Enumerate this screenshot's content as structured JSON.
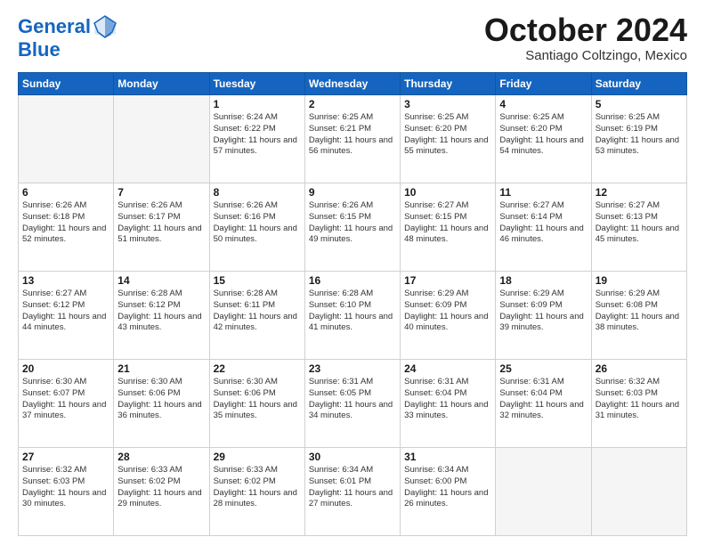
{
  "header": {
    "logo_line1": "General",
    "logo_line2": "Blue",
    "month": "October 2024",
    "location": "Santiago Coltzingo, Mexico"
  },
  "days_of_week": [
    "Sunday",
    "Monday",
    "Tuesday",
    "Wednesday",
    "Thursday",
    "Friday",
    "Saturday"
  ],
  "weeks": [
    [
      {
        "day": "",
        "empty": true
      },
      {
        "day": "",
        "empty": true
      },
      {
        "day": "1",
        "sunrise": "6:24 AM",
        "sunset": "6:22 PM",
        "daylight": "11 hours and 57 minutes."
      },
      {
        "day": "2",
        "sunrise": "6:25 AM",
        "sunset": "6:21 PM",
        "daylight": "11 hours and 56 minutes."
      },
      {
        "day": "3",
        "sunrise": "6:25 AM",
        "sunset": "6:20 PM",
        "daylight": "11 hours and 55 minutes."
      },
      {
        "day": "4",
        "sunrise": "6:25 AM",
        "sunset": "6:20 PM",
        "daylight": "11 hours and 54 minutes."
      },
      {
        "day": "5",
        "sunrise": "6:25 AM",
        "sunset": "6:19 PM",
        "daylight": "11 hours and 53 minutes."
      }
    ],
    [
      {
        "day": "6",
        "sunrise": "6:26 AM",
        "sunset": "6:18 PM",
        "daylight": "11 hours and 52 minutes."
      },
      {
        "day": "7",
        "sunrise": "6:26 AM",
        "sunset": "6:17 PM",
        "daylight": "11 hours and 51 minutes."
      },
      {
        "day": "8",
        "sunrise": "6:26 AM",
        "sunset": "6:16 PM",
        "daylight": "11 hours and 50 minutes."
      },
      {
        "day": "9",
        "sunrise": "6:26 AM",
        "sunset": "6:15 PM",
        "daylight": "11 hours and 49 minutes."
      },
      {
        "day": "10",
        "sunrise": "6:27 AM",
        "sunset": "6:15 PM",
        "daylight": "11 hours and 48 minutes."
      },
      {
        "day": "11",
        "sunrise": "6:27 AM",
        "sunset": "6:14 PM",
        "daylight": "11 hours and 46 minutes."
      },
      {
        "day": "12",
        "sunrise": "6:27 AM",
        "sunset": "6:13 PM",
        "daylight": "11 hours and 45 minutes."
      }
    ],
    [
      {
        "day": "13",
        "sunrise": "6:27 AM",
        "sunset": "6:12 PM",
        "daylight": "11 hours and 44 minutes."
      },
      {
        "day": "14",
        "sunrise": "6:28 AM",
        "sunset": "6:12 PM",
        "daylight": "11 hours and 43 minutes."
      },
      {
        "day": "15",
        "sunrise": "6:28 AM",
        "sunset": "6:11 PM",
        "daylight": "11 hours and 42 minutes."
      },
      {
        "day": "16",
        "sunrise": "6:28 AM",
        "sunset": "6:10 PM",
        "daylight": "11 hours and 41 minutes."
      },
      {
        "day": "17",
        "sunrise": "6:29 AM",
        "sunset": "6:09 PM",
        "daylight": "11 hours and 40 minutes."
      },
      {
        "day": "18",
        "sunrise": "6:29 AM",
        "sunset": "6:09 PM",
        "daylight": "11 hours and 39 minutes."
      },
      {
        "day": "19",
        "sunrise": "6:29 AM",
        "sunset": "6:08 PM",
        "daylight": "11 hours and 38 minutes."
      }
    ],
    [
      {
        "day": "20",
        "sunrise": "6:30 AM",
        "sunset": "6:07 PM",
        "daylight": "11 hours and 37 minutes."
      },
      {
        "day": "21",
        "sunrise": "6:30 AM",
        "sunset": "6:06 PM",
        "daylight": "11 hours and 36 minutes."
      },
      {
        "day": "22",
        "sunrise": "6:30 AM",
        "sunset": "6:06 PM",
        "daylight": "11 hours and 35 minutes."
      },
      {
        "day": "23",
        "sunrise": "6:31 AM",
        "sunset": "6:05 PM",
        "daylight": "11 hours and 34 minutes."
      },
      {
        "day": "24",
        "sunrise": "6:31 AM",
        "sunset": "6:04 PM",
        "daylight": "11 hours and 33 minutes."
      },
      {
        "day": "25",
        "sunrise": "6:31 AM",
        "sunset": "6:04 PM",
        "daylight": "11 hours and 32 minutes."
      },
      {
        "day": "26",
        "sunrise": "6:32 AM",
        "sunset": "6:03 PM",
        "daylight": "11 hours and 31 minutes."
      }
    ],
    [
      {
        "day": "27",
        "sunrise": "6:32 AM",
        "sunset": "6:03 PM",
        "daylight": "11 hours and 30 minutes."
      },
      {
        "day": "28",
        "sunrise": "6:33 AM",
        "sunset": "6:02 PM",
        "daylight": "11 hours and 29 minutes."
      },
      {
        "day": "29",
        "sunrise": "6:33 AM",
        "sunset": "6:02 PM",
        "daylight": "11 hours and 28 minutes."
      },
      {
        "day": "30",
        "sunrise": "6:34 AM",
        "sunset": "6:01 PM",
        "daylight": "11 hours and 27 minutes."
      },
      {
        "day": "31",
        "sunrise": "6:34 AM",
        "sunset": "6:00 PM",
        "daylight": "11 hours and 26 minutes."
      },
      {
        "day": "",
        "empty": true
      },
      {
        "day": "",
        "empty": true
      }
    ]
  ]
}
